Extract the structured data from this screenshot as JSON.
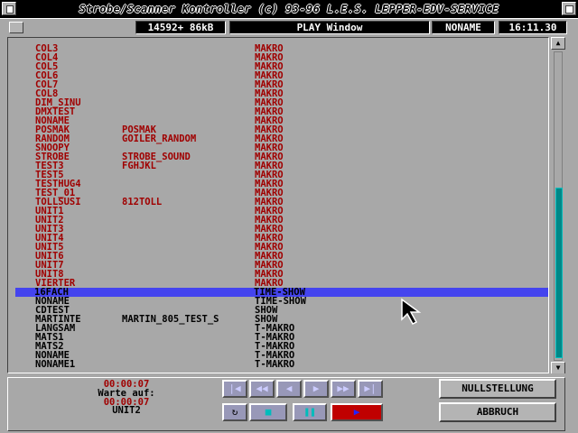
{
  "window": {
    "title": "Strobe/Scanner Kontroller (c) 93-96 L.E.S. LEPPER-EDV-SERVICE"
  },
  "status": {
    "memory": "14592+  86kB",
    "window_name": "PLAY Window",
    "project": "NONAME",
    "clock": "16:11.30"
  },
  "list": {
    "selected_index": 28,
    "rows": [
      {
        "name": "COL3",
        "extra": "",
        "type": "MAKRO",
        "kind": "macro"
      },
      {
        "name": "COL4",
        "extra": "",
        "type": "MAKRO",
        "kind": "macro"
      },
      {
        "name": "COL5",
        "extra": "",
        "type": "MAKRO",
        "kind": "macro"
      },
      {
        "name": "COL6",
        "extra": "",
        "type": "MAKRO",
        "kind": "macro"
      },
      {
        "name": "COL7",
        "extra": "",
        "type": "MAKRO",
        "kind": "macro"
      },
      {
        "name": "COL8",
        "extra": "",
        "type": "MAKRO",
        "kind": "macro"
      },
      {
        "name": "DIM_SINU",
        "extra": "",
        "type": "MAKRO",
        "kind": "macro"
      },
      {
        "name": "DMXTEST",
        "extra": "",
        "type": "MAKRO",
        "kind": "macro"
      },
      {
        "name": "NONAME",
        "extra": "",
        "type": "MAKRO",
        "kind": "macro"
      },
      {
        "name": "POSMAK",
        "extra": "POSMAK",
        "type": "MAKRO",
        "kind": "macro"
      },
      {
        "name": "RANDOM",
        "extra": "GOILER_RANDOM",
        "type": "MAKRO",
        "kind": "macro"
      },
      {
        "name": "SNOOPY",
        "extra": "",
        "type": "MAKRO",
        "kind": "macro"
      },
      {
        "name": "STROBE",
        "extra": "STROBE_SOUND",
        "type": "MAKRO",
        "kind": "macro"
      },
      {
        "name": "TEST3",
        "extra": "FGHJKL",
        "type": "MAKRO",
        "kind": "macro"
      },
      {
        "name": "TEST5",
        "extra": "",
        "type": "MAKRO",
        "kind": "macro"
      },
      {
        "name": "TESTHUG4",
        "extra": "",
        "type": "MAKRO",
        "kind": "macro"
      },
      {
        "name": "TEST_01",
        "extra": "",
        "type": "MAKRO",
        "kind": "macro"
      },
      {
        "name": "TOLLSUSI",
        "extra": "812TOLL",
        "type": "MAKRO",
        "kind": "macro"
      },
      {
        "name": "UNIT1",
        "extra": "",
        "type": "MAKRO",
        "kind": "macro"
      },
      {
        "name": "UNIT2",
        "extra": "",
        "type": "MAKRO",
        "kind": "macro"
      },
      {
        "name": "UNIT3",
        "extra": "",
        "type": "MAKRO",
        "kind": "macro"
      },
      {
        "name": "UNIT4",
        "extra": "",
        "type": "MAKRO",
        "kind": "macro"
      },
      {
        "name": "UNIT5",
        "extra": "",
        "type": "MAKRO",
        "kind": "macro"
      },
      {
        "name": "UNIT6",
        "extra": "",
        "type": "MAKRO",
        "kind": "macro"
      },
      {
        "name": "UNIT7",
        "extra": "",
        "type": "MAKRO",
        "kind": "macro"
      },
      {
        "name": "UNIT8",
        "extra": "",
        "type": "MAKRO",
        "kind": "macro"
      },
      {
        "name": "VIERTER",
        "extra": "",
        "type": "MAKRO",
        "kind": "macro"
      },
      {
        "name": "16FACH",
        "extra": "",
        "type": "TIME-SHOW",
        "kind": "show"
      },
      {
        "name": "NONAME",
        "extra": "",
        "type": "TIME-SHOW",
        "kind": "show"
      },
      {
        "name": "CDTEST",
        "extra": "",
        "type": "SHOW",
        "kind": "show"
      },
      {
        "name": "MARTINTE",
        "extra": "MARTIN_805_TEST_S",
        "type": "SHOW",
        "kind": "show"
      },
      {
        "name": "LANGSAM",
        "extra": "",
        "type": "T-MAKRO",
        "kind": "show"
      },
      {
        "name": "MATS1",
        "extra": "",
        "type": "T-MAKRO",
        "kind": "show"
      },
      {
        "name": "MATS2",
        "extra": "",
        "type": "T-MAKRO",
        "kind": "show"
      },
      {
        "name": "NONAME",
        "extra": "",
        "type": "T-MAKRO",
        "kind": "show"
      },
      {
        "name": "NONAME1",
        "extra": "",
        "type": "T-MAKRO",
        "kind": "show"
      }
    ]
  },
  "scroll": {
    "up_arrow": "▲",
    "down_arrow": "▼",
    "visible_start_fraction": 0.44,
    "visible_fraction": 0.56
  },
  "info": {
    "time1": "00:00:07",
    "wait_label": "Warte auf:",
    "time2": "00:00:07",
    "unit": "UNIT2"
  },
  "transport": {
    "first": "|◀",
    "rewind": "◀◀",
    "back": "◀",
    "forward": "▶",
    "fast_forward": "▶▶",
    "last": "▶|",
    "loop": "↻",
    "stop": "■",
    "pause": "❚❚",
    "play": "▶"
  },
  "buttons": {
    "reset": "NULLSTELLUNG",
    "abort": "ABBRUCH"
  },
  "colors": {
    "macro": "#a00000",
    "selected": "#4444ee",
    "thumb": "#008888",
    "play_active": "#c00000"
  }
}
